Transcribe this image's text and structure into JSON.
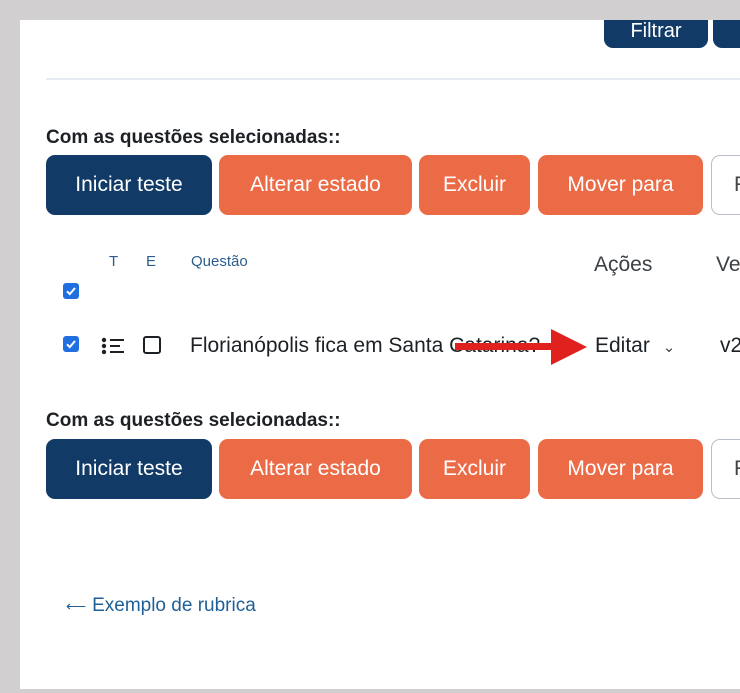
{
  "toolbar_top": {
    "filter_label": "Filtrar"
  },
  "bulk_actions_top": {
    "title": "Com as questões selecionadas::",
    "buttons": [
      "Iniciar teste",
      "Alterar estado",
      "Excluir",
      "Mover para",
      "F"
    ]
  },
  "table": {
    "headers": {
      "type": "T",
      "status": "E",
      "question": "Questão",
      "actions": "Ações",
      "version": "Ve"
    },
    "select_all_checked": true,
    "rows": [
      {
        "checked": true,
        "icon": "list-icon",
        "name": "Florianópolis fica em Santa Catarina?",
        "action": "Editar",
        "version": "v2"
      }
    ]
  },
  "bulk_actions_bottom": {
    "title": "Com as questões selecionadas::",
    "buttons": [
      "Iniciar teste",
      "Alterar estado",
      "Excluir",
      "Mover para",
      "F"
    ]
  },
  "footer_link": {
    "label": "Exemplo de rubrica",
    "icon": "arrow-left-icon"
  },
  "colors": {
    "primary": "#113a66",
    "danger": "#ec6b47",
    "checkbox": "#1f6fe0",
    "annotation_arrow": "#e0211d"
  }
}
